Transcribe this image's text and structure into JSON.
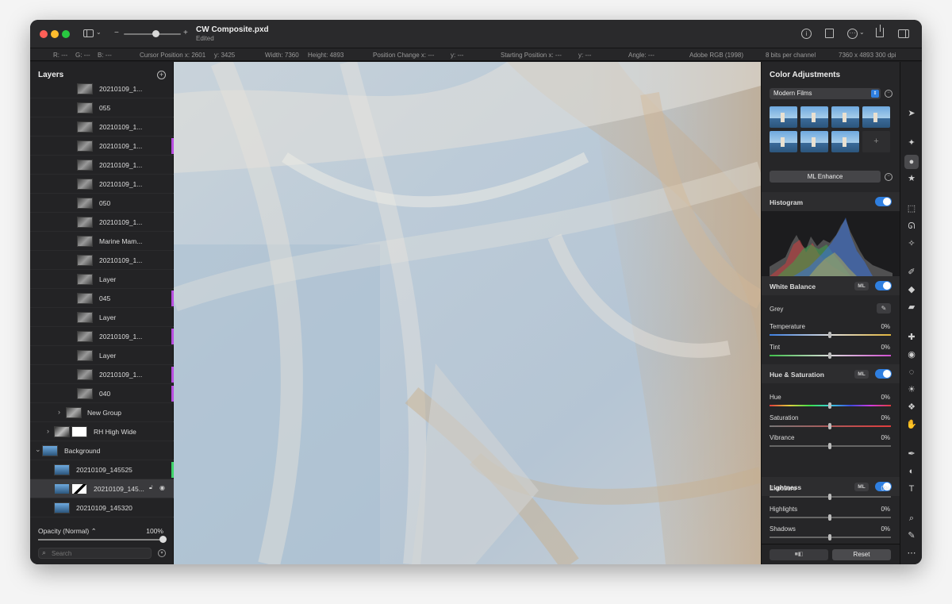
{
  "window": {
    "title": "CW Composite.pxd",
    "subtitle": "Edited"
  },
  "infobar": {
    "r": "R: ---",
    "g": "G: ---",
    "b": "B: ---",
    "cursor_x": "Cursor Position x: 2601",
    "cursor_y": "y: 3425",
    "width": "Width: 7360",
    "height": "Height: 4893",
    "change_x": "Position Change x: ---",
    "change_y": "y: ---",
    "start_x": "Starting Position x: ---",
    "start_y": "y: ---",
    "angle": "Angle: ---",
    "profile": "Adobe RGB (1998)",
    "bits": "8 bits per channel",
    "size": "7360 x 4893 300 dpi"
  },
  "layers": {
    "title": "Layers",
    "items": [
      {
        "name": "20210109_1...",
        "mark": ""
      },
      {
        "name": "055",
        "mark": ""
      },
      {
        "name": "20210109_1...",
        "mark": ""
      },
      {
        "name": "20210109_1...",
        "mark": "#b84fe0"
      },
      {
        "name": "20210109_1...",
        "mark": ""
      },
      {
        "name": "20210109_1...",
        "mark": ""
      },
      {
        "name": "050",
        "mark": ""
      },
      {
        "name": "20210109_1...",
        "mark": ""
      },
      {
        "name": "Marine Mam...",
        "mark": ""
      },
      {
        "name": "20210109_1...",
        "mark": ""
      },
      {
        "name": "Layer",
        "mark": ""
      },
      {
        "name": "045",
        "mark": "#b84fe0"
      },
      {
        "name": "Layer",
        "mark": ""
      },
      {
        "name": "20210109_1...",
        "mark": "#b84fe0"
      },
      {
        "name": "Layer",
        "mark": ""
      },
      {
        "name": "20210109_1...",
        "mark": "#b84fe0"
      },
      {
        "name": "040",
        "mark": "#b84fe0"
      }
    ],
    "group": "New Group",
    "rh": "RH High Wide",
    "background": "Background",
    "bg_children": [
      {
        "name": "20210109_145525",
        "mark": "#3fd46a"
      },
      {
        "name": "20210109_145...",
        "mark": ""
      },
      {
        "name": "20210109_145320",
        "mark": ""
      }
    ],
    "opacity_label": "Opacity (Normal) ⌃",
    "opacity_value": "100%",
    "opacity_level": 1.0,
    "search_placeholder": "Search"
  },
  "adjust": {
    "title": "Color Adjustments",
    "preset_select": "Modern Films",
    "ml_enhance": "ML Enhance",
    "histogram": "Histogram",
    "white_balance": {
      "title": "White Balance",
      "ml": "ML",
      "grey": "Grey",
      "sliders": [
        {
          "label": "Temperature",
          "value": "0%"
        },
        {
          "label": "Tint",
          "value": "0%"
        }
      ]
    },
    "hue_sat": {
      "title": "Hue & Saturation",
      "ml": "ML",
      "sliders": [
        {
          "label": "Hue",
          "value": "0%"
        },
        {
          "label": "Saturation",
          "value": "0%"
        },
        {
          "label": "Vibrance",
          "value": "0%"
        }
      ]
    },
    "lightness": {
      "title": "Lightness",
      "ml": "ML",
      "sliders": [
        {
          "label": "Exposure",
          "value": "0%"
        },
        {
          "label": "Highlights",
          "value": "0%"
        },
        {
          "label": "Shadows",
          "value": "0%"
        }
      ]
    },
    "reset": "Reset"
  },
  "colors": {
    "accent": "#2f7fe0",
    "purple_mark": "#b84fe0",
    "green_mark": "#3fd46a"
  }
}
